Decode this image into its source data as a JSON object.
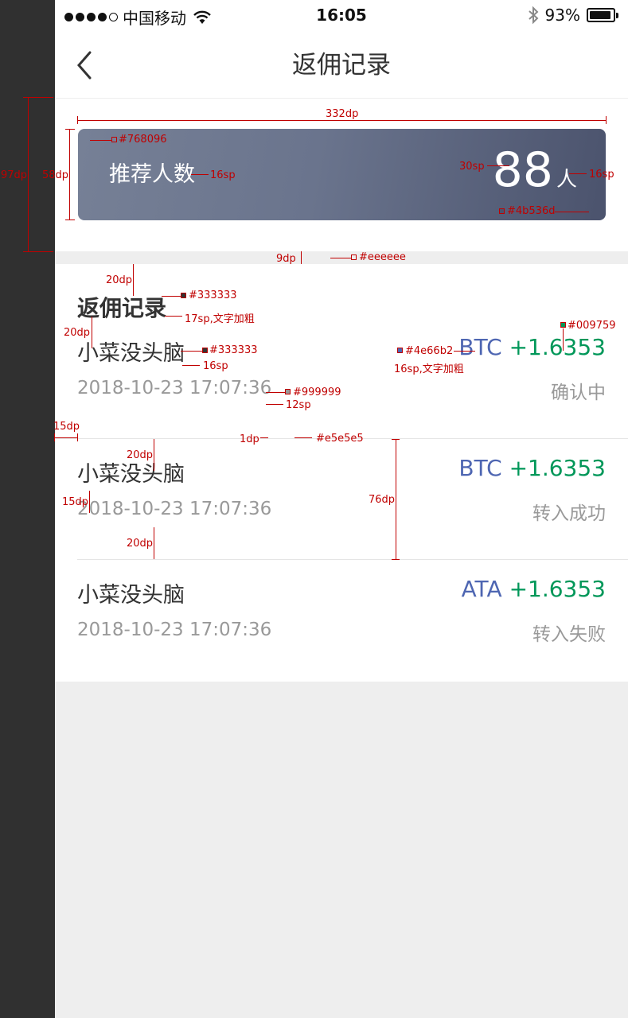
{
  "status_bar": {
    "carrier": "中国移动",
    "time": "16:05",
    "battery": "93%",
    "battery_level": 0.93
  },
  "nav": {
    "title": "返佣记录",
    "back_icon": "chevron-left-icon"
  },
  "banner": {
    "label": "推荐人数",
    "count": "88",
    "unit": "人",
    "gradient_start": "#768096",
    "gradient_end": "#4b536d"
  },
  "records": {
    "title": "返佣记录",
    "items": [
      {
        "name": "小菜没头脑",
        "coin": "BTC",
        "amount": "+1.6353",
        "date": "2018-10-23 17:07:36",
        "status": "确认中"
      },
      {
        "name": "小菜没头脑",
        "coin": "BTC",
        "amount": "+1.6353",
        "date": "2018-10-23 17:07:36",
        "status": "转入成功"
      },
      {
        "name": "小菜没头脑",
        "coin": "ATA",
        "amount": "+1.6353",
        "date": "2018-10-23 17:07:36",
        "status": "转入失败"
      }
    ]
  },
  "colors": {
    "title_text": "#333333",
    "secondary_text": "#999999",
    "coin": "#4e66b2",
    "amount": "#009759",
    "divider": "#e5e5e5",
    "gap": "#eeeeee"
  },
  "annotations": {
    "a97dp": "97dp",
    "a58dp": "58dp",
    "a332dp": "332dp",
    "c768096": "#768096",
    "a30sp": "30sp",
    "a16sp_label": "16sp",
    "a16sp_unit": "16sp",
    "c4b536d": "#4b536d",
    "a9dp": "9dp",
    "ceeeeee": "#eeeeee",
    "a20dp_1": "20dp",
    "c333333_1": "#333333",
    "a17sp": "17sp,文字加粗",
    "a20dp_2": "20dp",
    "c009759": "#009759",
    "c333333_2": "#333333",
    "c4e66b2": "#4e66b2",
    "a16sp_name": "16sp",
    "a16sp_bold": "16sp,文字加粗",
    "c999999": "#999999",
    "a12sp": "12sp",
    "a15dp_1": "15dp",
    "a1dp": "1dp",
    "ce5e5e5": "#e5e5e5",
    "a20dp_3": "20dp",
    "a76dp": "76dp",
    "a15dp_2": "15dp",
    "a20dp_4": "20dp"
  }
}
